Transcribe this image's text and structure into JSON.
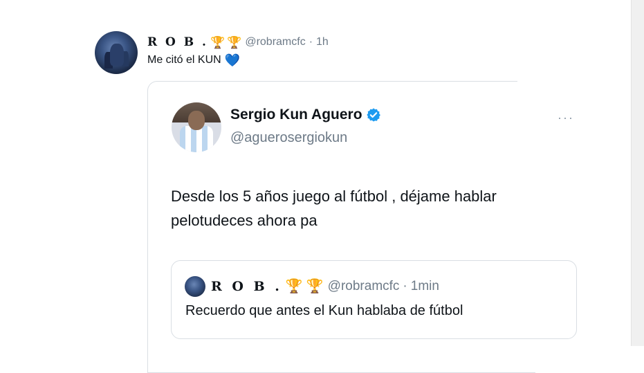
{
  "outer_tweet": {
    "author_name": "R O B .",
    "trophies": [
      "🏆",
      "🏆"
    ],
    "handle": "@robramcfc",
    "separator": "·",
    "time": "1h",
    "text": "Me citó el KUN",
    "emoji": "💙",
    "avatar_icon": "user-avatar-icon"
  },
  "quoted_tweet": {
    "author_name": "Sergio Kun Aguero",
    "verified": true,
    "handle": "@aguerosergiokun",
    "more_label": "···",
    "text": "Desde los 5 años juego al fútbol , déjame hablar pelotudeces ahora pa",
    "avatar_icon": "user-avatar-icon"
  },
  "nested_quote": {
    "author_name": "R O B .",
    "trophies": [
      "🏆",
      "🏆"
    ],
    "handle": "@robramcfc",
    "separator": "·",
    "time": "1min",
    "text": "Recuerdo que antes el Kun hablaba de fútbol"
  },
  "colors": {
    "text_primary": "#0f1419",
    "text_muted": "#6d7a87",
    "verified_blue": "#1d9bf0",
    "heart_blue": "#5fa8e8",
    "border": "#d9dee3"
  }
}
